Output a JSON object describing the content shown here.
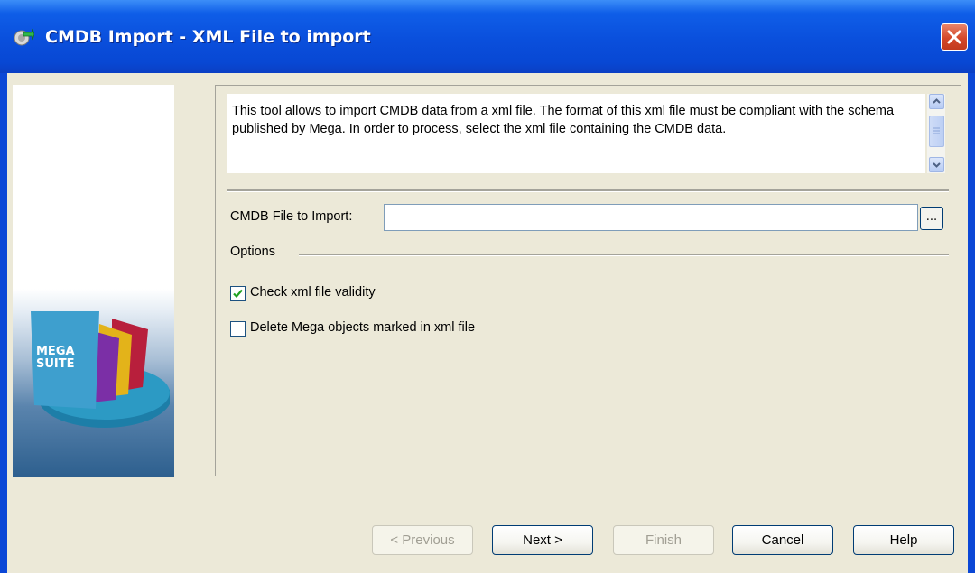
{
  "window": {
    "title": "CMDB Import - XML File to import"
  },
  "banner": {
    "logo_line1": "MEGA",
    "logo_line2": "SUITE"
  },
  "description": "This tool allows to import CMDB data from a xml file. The format of this xml file must be compliant with the schema published by Mega. In order to process, select the xml file containing the CMDB data.",
  "file_field": {
    "label": "CMDB File to Import:",
    "value": "",
    "browse_label": "..."
  },
  "options": {
    "label": "Options",
    "items": [
      {
        "label": "Check xml file validity",
        "checked": true
      },
      {
        "label": "Delete Mega objects marked in xml file",
        "checked": false
      }
    ]
  },
  "buttons": {
    "previous": "< Previous",
    "next": "Next >",
    "finish": "Finish",
    "cancel": "Cancel",
    "help": "Help"
  },
  "colors": {
    "title_bar": "#0a4fdc",
    "dialog_bg": "#ece9d8",
    "close_button": "#d4482a"
  }
}
